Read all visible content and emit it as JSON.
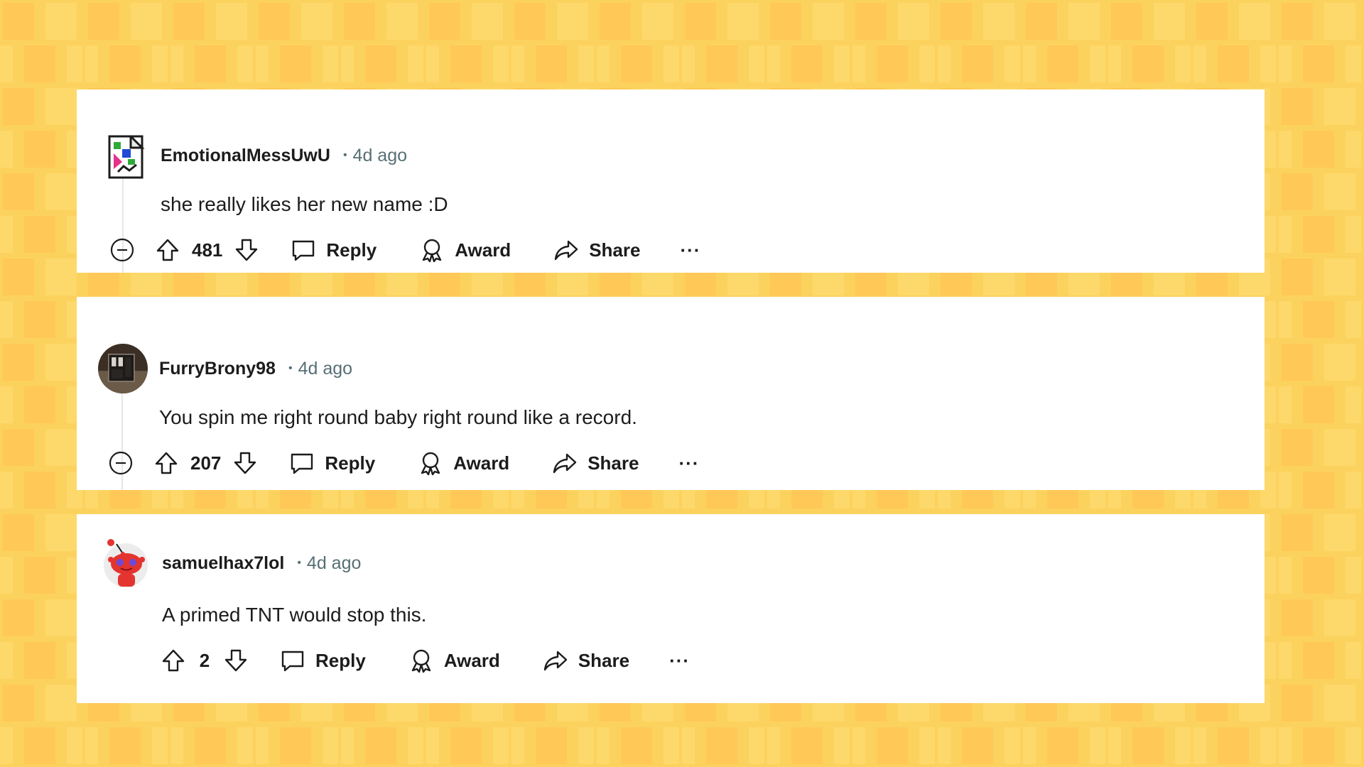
{
  "colors": {
    "background": "#fcd25e",
    "card": "#ffffff",
    "text": "#1c1c1c",
    "muted": "#576f76"
  },
  "comments": [
    {
      "username": "EmotionalMessUwU",
      "separator": "•",
      "time": "4d ago",
      "text": "she really likes her new name :D",
      "votes": "481",
      "avatar_icon": "broken-image-avatar-icon",
      "actions": {
        "reply": "Reply",
        "award": "Award",
        "share": "Share",
        "more": "···"
      }
    },
    {
      "username": "FurryBrony98",
      "separator": "•",
      "time": "4d ago",
      "text": "You spin me right round baby right round like a record.",
      "votes": "207",
      "avatar_icon": "photo-avatar-icon",
      "actions": {
        "reply": "Reply",
        "award": "Award",
        "share": "Share",
        "more": "···"
      }
    },
    {
      "username": "samuelhax7lol",
      "separator": "•",
      "time": "4d ago",
      "text": "A primed TNT would stop this.",
      "votes": "2",
      "avatar_icon": "snoo-avatar-icon",
      "actions": {
        "reply": "Reply",
        "award": "Award",
        "share": "Share",
        "more": "···"
      }
    }
  ]
}
